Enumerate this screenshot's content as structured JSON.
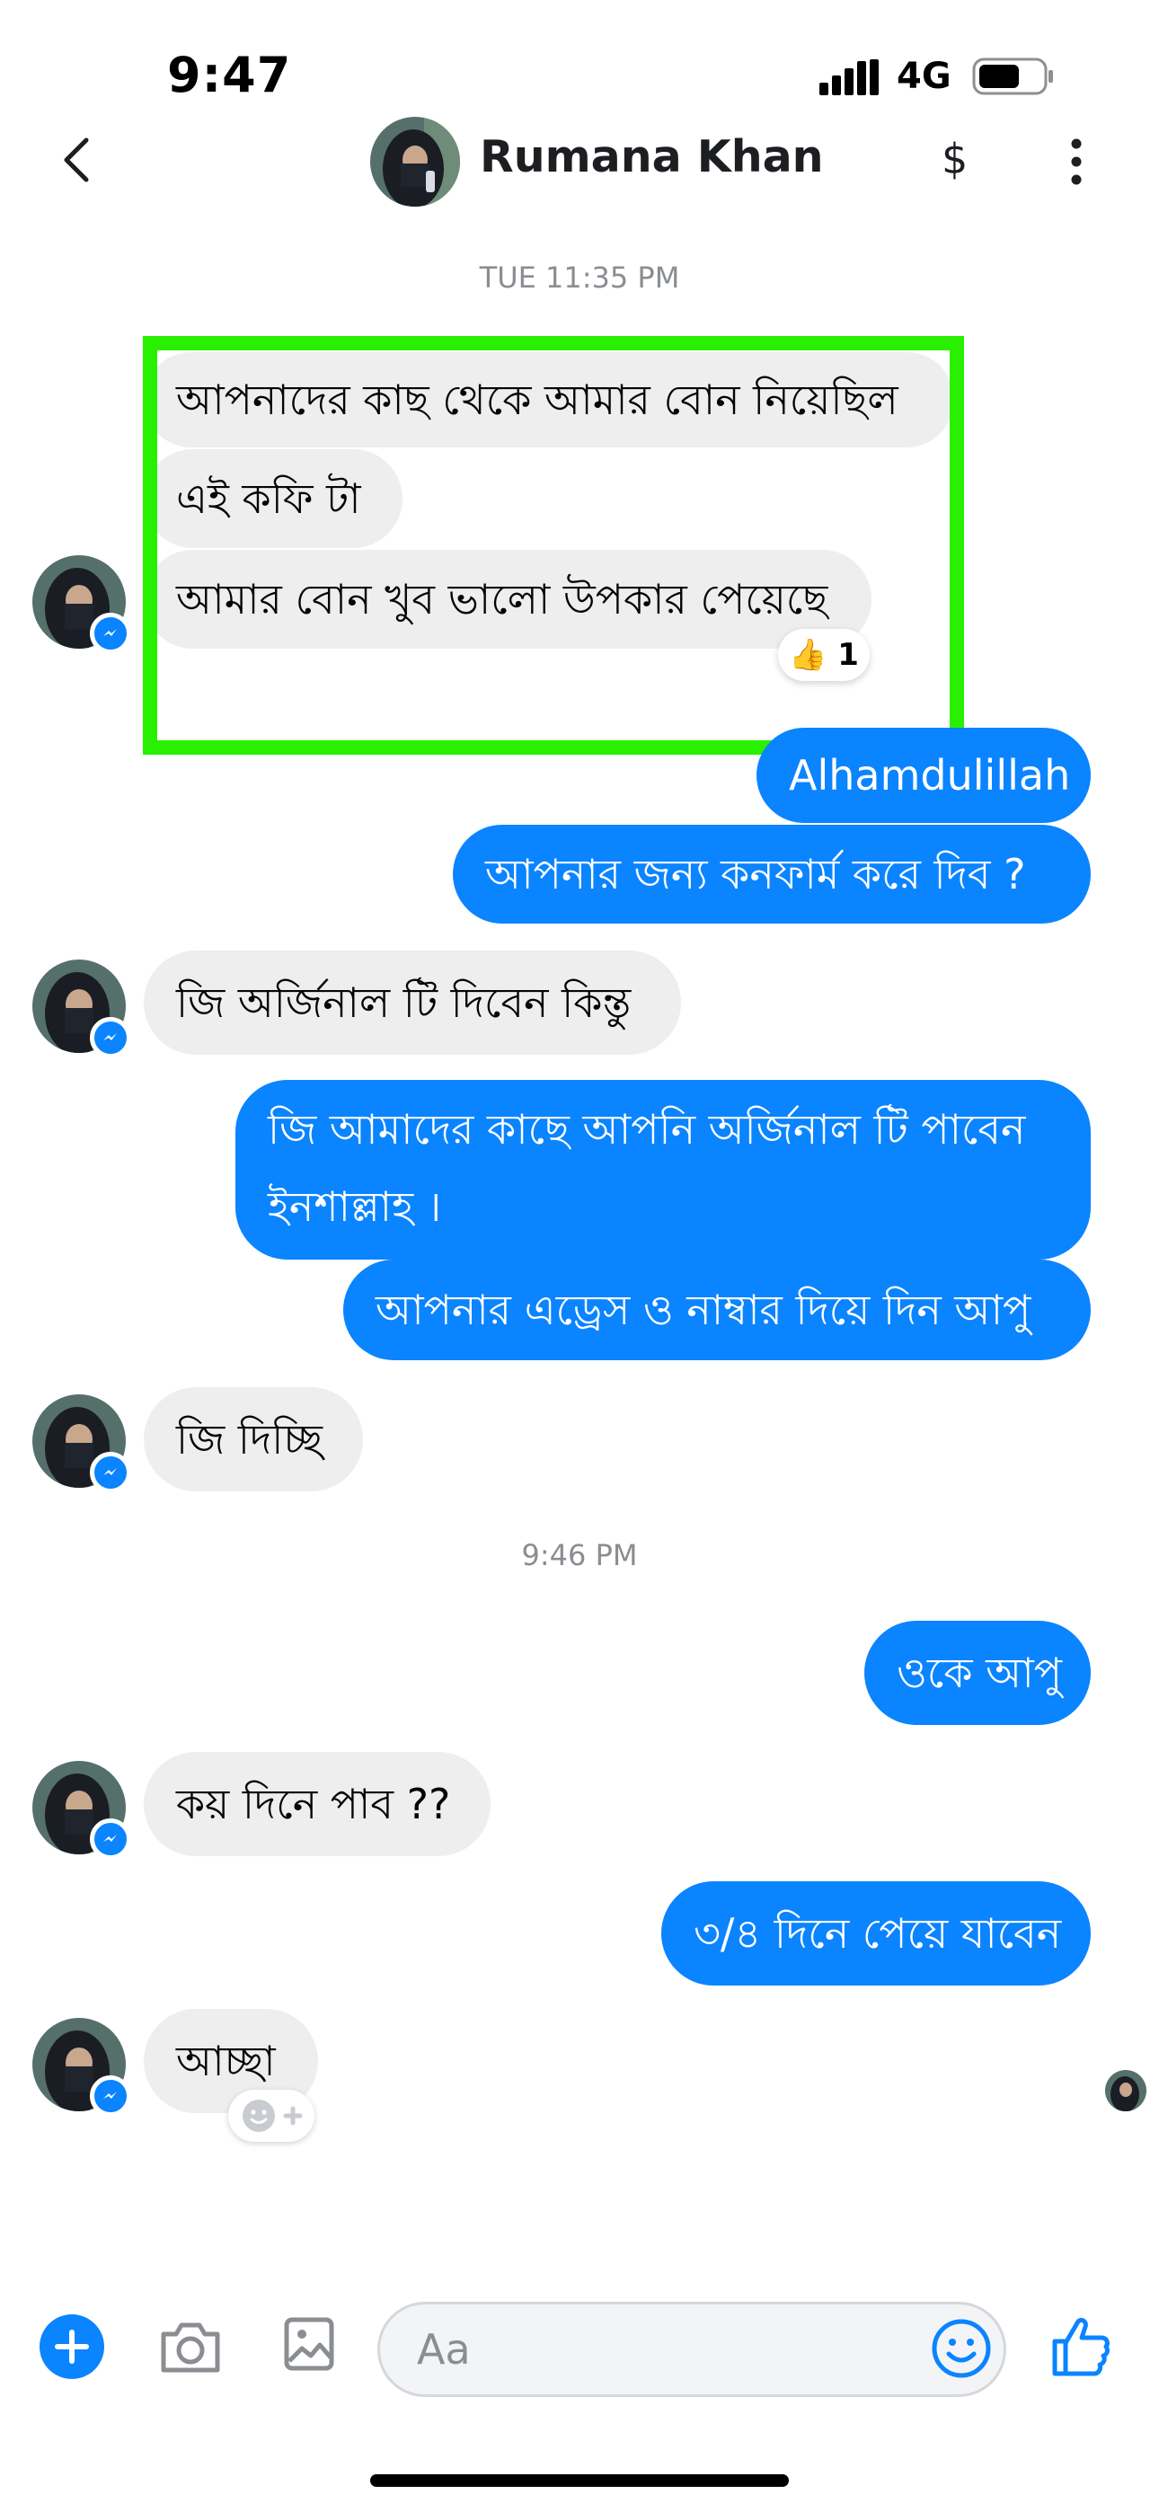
{
  "status_bar": {
    "time": "9:47",
    "network": "4G"
  },
  "header": {
    "contact_name": "Rumana Khan",
    "currency_symbol": "$"
  },
  "timestamps": {
    "first": "TUE 11:35 PM",
    "second": "9:46 PM"
  },
  "messages": {
    "m1": "আপনাদের কাছ থেকে আমার বোন নিয়েছিল",
    "m2": "এই কফি টা",
    "m3": "আমার বোন খুব ভালো উপকার পেয়েছে",
    "m3_reaction_count": "1",
    "m4": "Alhamdulillah",
    "m5": "আপনার জন্য কনফার্ম করে দিব ?",
    "m6": "জি অর্জিনাল টি দিবেন কিন্তু",
    "m7": "জি আমাদের কাছে আপনি অর্জিনাল টি পাবেন ইনশাল্লাহ ।",
    "m8": "আপনার এড্রেস ও নাম্বার দিয়ে দিন আপু",
    "m9": "জি দিচ্ছি",
    "m10": "ওকে আপু",
    "m11": "কয় দিনে পাব ??",
    "m12": "৩/৪ দিনে পেয়ে যাবেন",
    "m13": "আচ্ছা"
  },
  "composer": {
    "placeholder": "Aa"
  },
  "colors": {
    "accent": "#0a84ff",
    "incoming_bubble": "#eeeeef",
    "highlight": "#28f000"
  }
}
